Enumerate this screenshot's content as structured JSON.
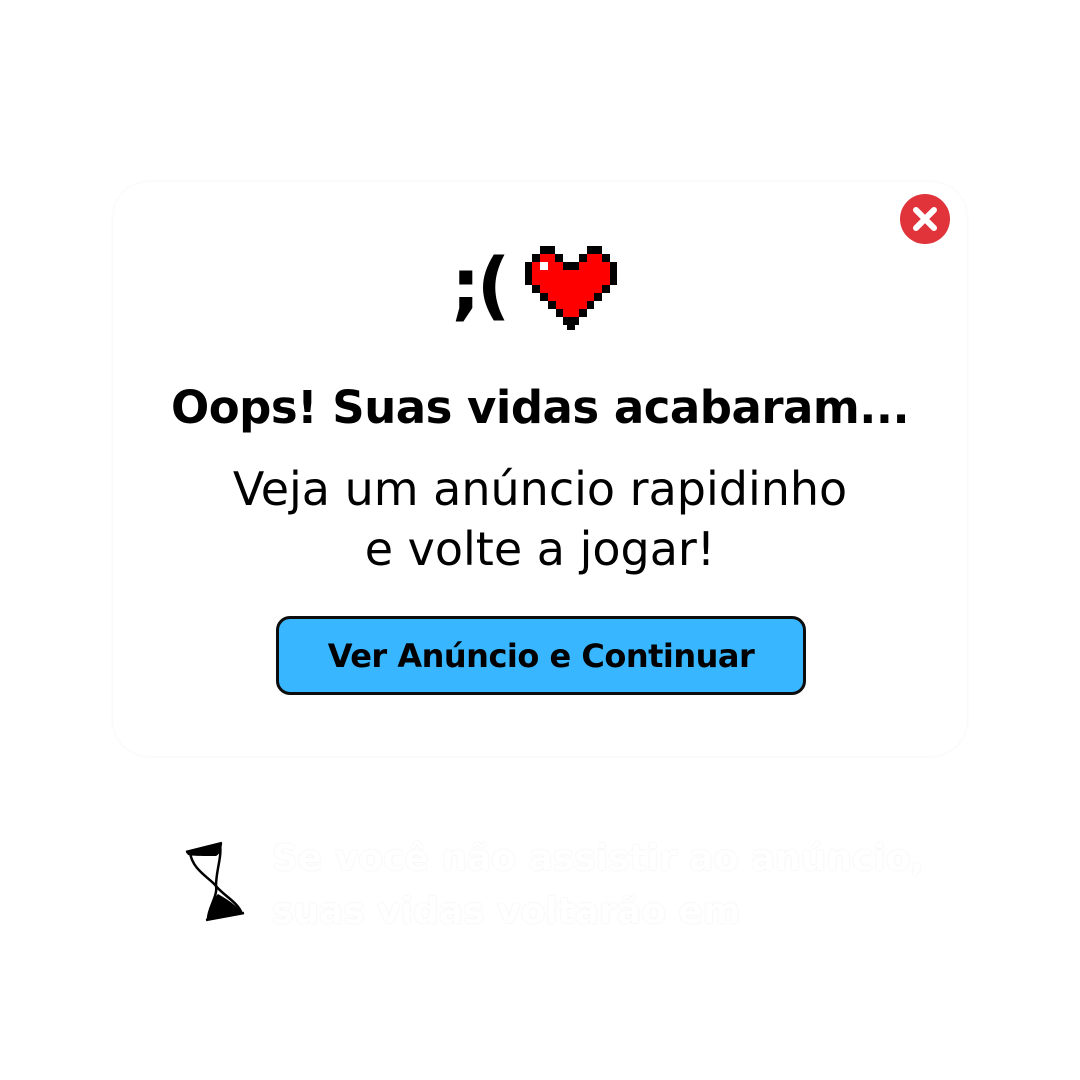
{
  "modal": {
    "emote": ";(",
    "headline": "Oops! Suas vidas acabaram...",
    "subtitle_line1": "Veja um anúncio rapidinho",
    "subtitle_line2": "e volte a jogar!",
    "cta_label": "Ver Anúncio e Continuar",
    "close_icon": "close-icon",
    "heart_icon": "pixel-heart-icon"
  },
  "footer": {
    "icon": "hourglass-icon",
    "notice_line1": "Se você não assistir ao anúncio,",
    "notice_line2": "suas vidas voltarão em"
  },
  "colors": {
    "accent": "#38b6ff",
    "close": "#e0333a",
    "heart": "#ff0000"
  }
}
